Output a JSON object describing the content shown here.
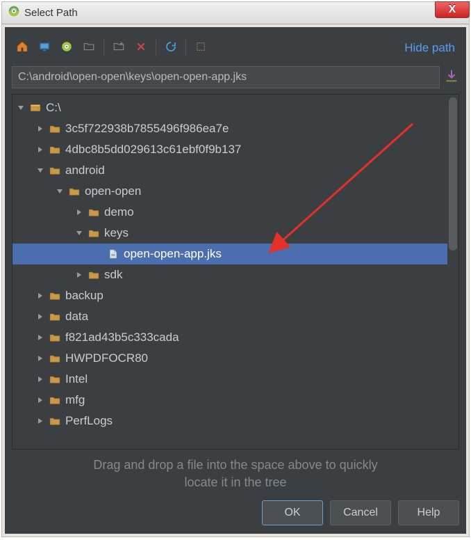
{
  "titlebar": {
    "title": "Select Path"
  },
  "toolbar": {
    "hide_path_label": "Hide path"
  },
  "path": {
    "value": "C:\\android\\open-open\\keys\\open-open-app.jks"
  },
  "tree": [
    {
      "depth": 0,
      "kind": "drive",
      "expanded": true,
      "label": "C:\\",
      "selected": false
    },
    {
      "depth": 1,
      "kind": "folder",
      "expanded": false,
      "label": "3c5f722938b7855496f986ea7e",
      "selected": false
    },
    {
      "depth": 1,
      "kind": "folder",
      "expanded": false,
      "label": "4dbc8b5dd029613c61ebf0f9b137",
      "selected": false
    },
    {
      "depth": 1,
      "kind": "folder",
      "expanded": true,
      "label": "android",
      "selected": false
    },
    {
      "depth": 2,
      "kind": "folder",
      "expanded": true,
      "label": "open-open",
      "selected": false
    },
    {
      "depth": 3,
      "kind": "folder",
      "expanded": false,
      "label": "demo",
      "selected": false
    },
    {
      "depth": 3,
      "kind": "folder",
      "expanded": true,
      "label": "keys",
      "selected": false
    },
    {
      "depth": 4,
      "kind": "file",
      "expanded": null,
      "label": "open-open-app.jks",
      "selected": true
    },
    {
      "depth": 3,
      "kind": "folder",
      "expanded": false,
      "label": "sdk",
      "selected": false
    },
    {
      "depth": 1,
      "kind": "folder",
      "expanded": false,
      "label": "backup",
      "selected": false
    },
    {
      "depth": 1,
      "kind": "folder",
      "expanded": false,
      "label": "data",
      "selected": false
    },
    {
      "depth": 1,
      "kind": "folder",
      "expanded": false,
      "label": "f821ad43b5c333cada",
      "selected": false
    },
    {
      "depth": 1,
      "kind": "folder",
      "expanded": false,
      "label": "HWPDFOCR80",
      "selected": false
    },
    {
      "depth": 1,
      "kind": "folder",
      "expanded": false,
      "label": "Intel",
      "selected": false
    },
    {
      "depth": 1,
      "kind": "folder",
      "expanded": false,
      "label": "mfg",
      "selected": false
    },
    {
      "depth": 1,
      "kind": "folder",
      "expanded": false,
      "label": "PerfLogs",
      "selected": false
    }
  ],
  "hint": {
    "line1": "Drag and drop a file into the space above to quickly",
    "line2": "locate it in the tree"
  },
  "buttons": {
    "ok": "OK",
    "cancel": "Cancel",
    "help": "Help"
  }
}
